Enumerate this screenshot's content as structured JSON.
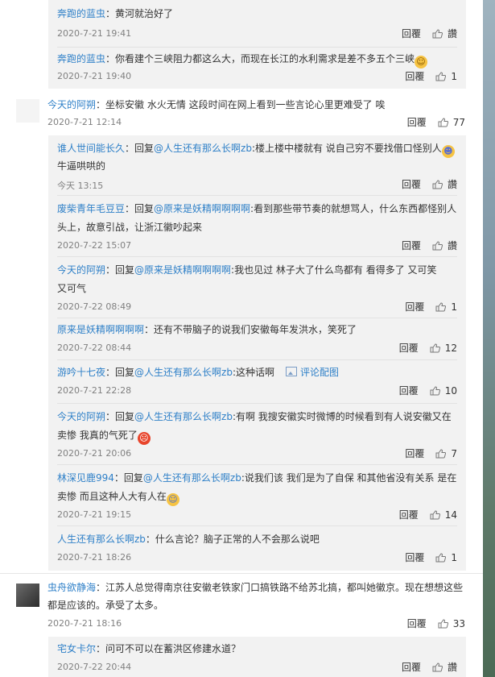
{
  "labels": {
    "reply": "回覆",
    "like": "讚"
  },
  "sub1": {
    "c1": {
      "name": "奔跑的蓝虫",
      "text": "：黄河就治好了",
      "time": "2020-7-21 19:41"
    },
    "c2": {
      "name": "奔跑的蓝虫",
      "text": "：你看建个三峡阻力都这么大，而现在长江的水利需求是差不多五个三峡",
      "time": "2020-7-21 19:40",
      "likes": "1"
    }
  },
  "top1": {
    "name": "今天的阿朔",
    "text": "：坐标安徽  水火无情  这段时间在网上看到一些言论心里更难受了   唉",
    "time": "2020-7-21 12:14",
    "likes": "77"
  },
  "sub2": {
    "c1": {
      "name": "谁人世间能长久",
      "pre": "：回复",
      "mention": "@人生还有那么长啊zb",
      "text": ":楼上楼中楼就有 说自己穷不要找借口怪别人",
      "line2": "牛逼哄哄的",
      "time": "今天 13:15"
    },
    "c2": {
      "name": "废柴青年毛豆豆",
      "pre": "：回复",
      "mention": "@原来是妖精啊啊啊啊",
      "text": ":看到那些带节奏的就想骂人，什么东西都怪别人",
      "line2": "头上，故意引战，让浙江徽吵起来",
      "time": "2020-7-22 15:07"
    },
    "c3": {
      "name": "今天的阿朔",
      "pre": "：回复",
      "mention": "@原来是妖精啊啊啊啊",
      "text": ":我也见过   林子大了什么鸟都有   看得多了   又可笑",
      "line2": "又可气",
      "time": "2020-7-22 08:49",
      "likes": "1"
    },
    "c4": {
      "name": "原来是妖精啊啊啊啊",
      "text": "：还有不带脑子的说我们安徽每年发洪水，笑死了",
      "time": "2020-7-22 08:44",
      "likes": "12"
    },
    "c5": {
      "name": "游吟十七夜",
      "pre": "：回复",
      "mention": "@人生还有那么长啊zb",
      "text": ":这种话啊",
      "pic": "评论配图",
      "time": "2020-7-21 22:28",
      "likes": "10"
    },
    "c6": {
      "name": "今天的阿朔",
      "pre": "：回复",
      "mention": "@人生还有那么长啊zb",
      "text": ":有啊   我搜安徽实时微博的时候看到有人说安徽又在",
      "line2": "卖惨   我真的气死了",
      "time": "2020-7-21 20:06",
      "likes": "7"
    },
    "c7": {
      "name": "林深见鹿994",
      "pre": "：回复",
      "mention": "@人生还有那么长啊zb",
      "text": ":说我们该 我们是为了自保 和其他省没有关系 是在",
      "line2": "卖惨 而且这种人大有人在",
      "time": "2020-7-21 19:15",
      "likes": "14"
    },
    "c8": {
      "name": "人生还有那么长啊zb",
      "text": "：什么言论？脑子正常的人不会那么说吧",
      "time": "2020-7-21 18:26",
      "likes": "1"
    }
  },
  "top2": {
    "name": "虫舟欲静海",
    "text": "：江苏人总觉得南京往安徽老铁家门口搞铁路不给苏北搞，都叫她徽京。现在想想这些",
    "line2": "都是应该的。承受了太多。",
    "time": "2020-7-21 18:16",
    "likes": "33"
  },
  "sub3": {
    "c1": {
      "name": "宅女卡尔",
      "text": "：问可不可以在蓄洪区修建水道？",
      "time": "2020-7-22 20:44"
    }
  }
}
